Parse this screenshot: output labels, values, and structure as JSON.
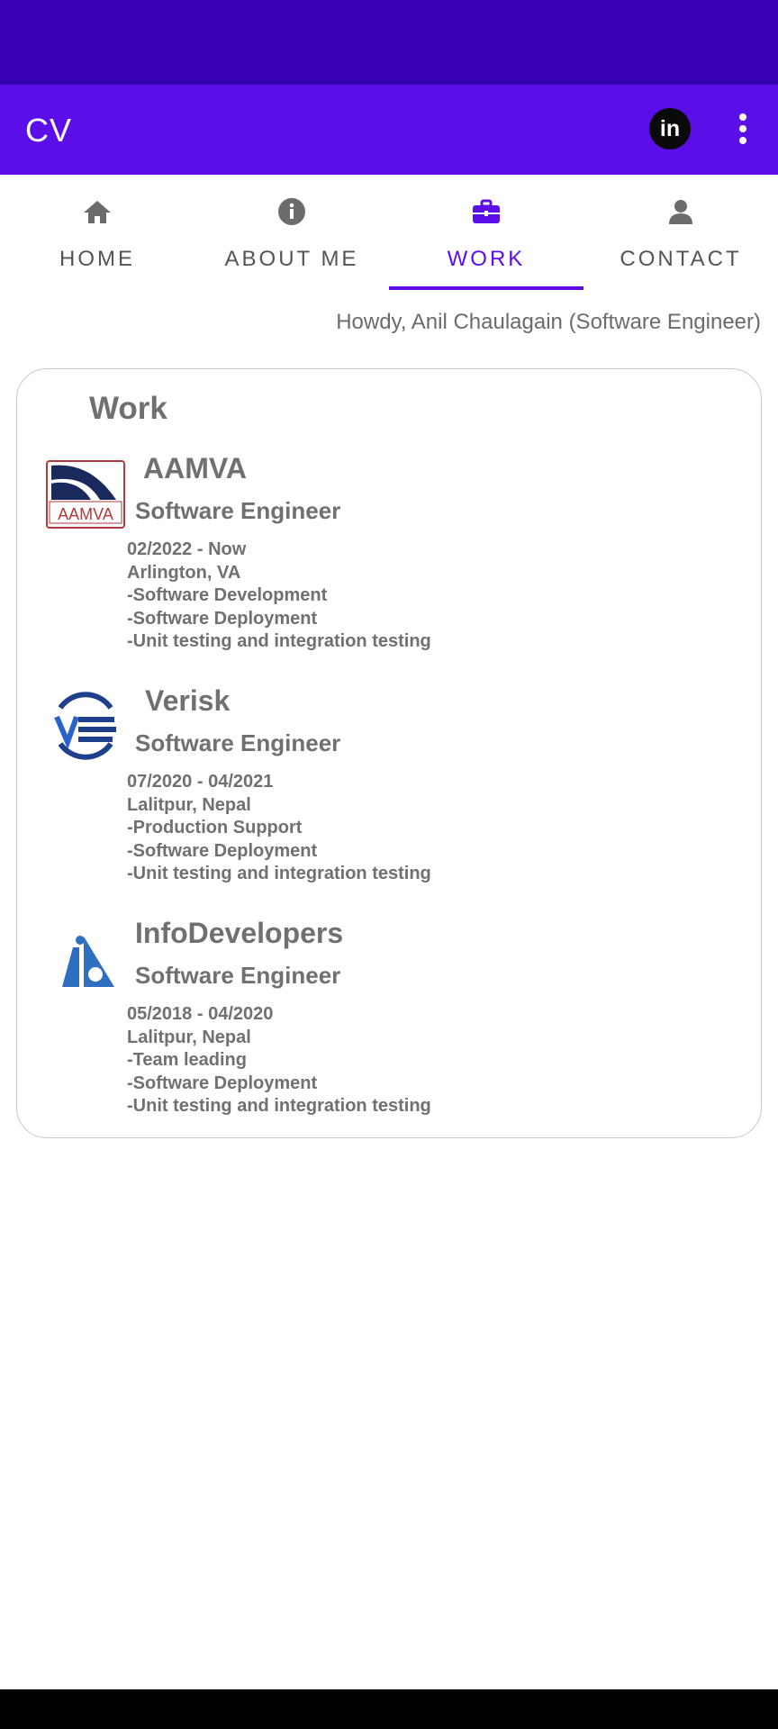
{
  "app": {
    "title": "CV"
  },
  "tabs": [
    {
      "label": "HOME",
      "icon": "home-icon"
    },
    {
      "label": "ABOUT ME",
      "icon": "info-icon"
    },
    {
      "label": "WORK",
      "icon": "briefcase-icon"
    },
    {
      "label": "CONTACT",
      "icon": "person-icon"
    }
  ],
  "greeting": "Howdy, Anil Chaulagain (Software Engineer)",
  "work": {
    "title": "Work",
    "jobs": [
      {
        "company": "AAMVA",
        "role": "Software Engineer",
        "dates": "02/2022 - Now",
        "location": "Arlington, VA",
        "duties": [
          "-Software Development",
          "-Software Deployment",
          "-Unit testing and integration testing"
        ],
        "logo_text": "AAMVA"
      },
      {
        "company": "Verisk",
        "role": "Software Engineer",
        "dates": "07/2020 - 04/2021",
        "location": "Lalitpur, Nepal",
        "duties": [
          "-Production Support",
          "-Software Deployment",
          "-Unit testing and integration testing"
        ]
      },
      {
        "company": "InfoDevelopers",
        "role": "Software Engineer",
        "dates": "05/2018 - 04/2020",
        "location": "Lalitpur, Nepal",
        "duties": [
          "-Team leading",
          "-Software Deployment",
          "-Unit testing and integration testing"
        ]
      }
    ]
  },
  "colors": {
    "status_bar": "#3700b3",
    "app_bar": "#5c0ee8",
    "accent": "#5c0ee8",
    "text_gray": "#707070"
  }
}
